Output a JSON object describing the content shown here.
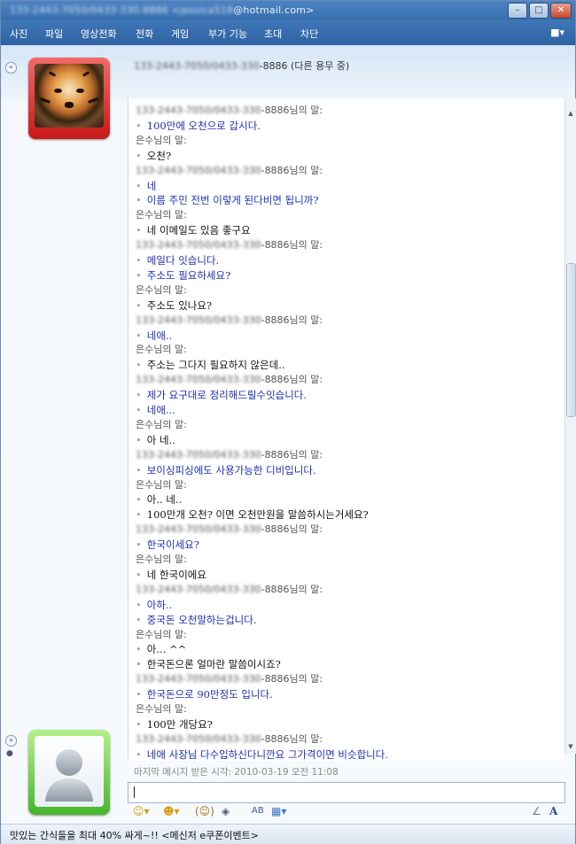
{
  "window": {
    "title_hidden": "133-2443-7050/0433-330-8886 <jessica518",
    "title_visible": "@hotmail.com>",
    "buttons": [
      "–",
      "□",
      "✕"
    ]
  },
  "menu": {
    "items": [
      "사진",
      "파일",
      "영상전화",
      "전화",
      "게임",
      "부가 기능",
      "초대",
      "차단"
    ],
    "right_icon": "■▾"
  },
  "contact": {
    "name_hidden": "133-2443-7050/0433-330",
    "name_visible": "-8886 (다른 용무 중)"
  },
  "chat": {
    "messages": [
      {
        "type": "speaker",
        "hidden": "133-2443-7050/0433-330",
        "text": "-8886님의 말:"
      },
      {
        "type": "msg",
        "side": "them",
        "text": "100만에 오천으로 갑시다."
      },
      {
        "type": "speaker",
        "hidden": "",
        "text": "은수님의 말:"
      },
      {
        "type": "msg",
        "side": "me",
        "text": "오천?"
      },
      {
        "type": "speaker",
        "hidden": "133-2443-7050/0433-330",
        "text": "-8886님의 말:"
      },
      {
        "type": "msg",
        "side": "them",
        "text": "네"
      },
      {
        "type": "msg",
        "side": "them",
        "text": "이름 주민 전번 이렇게 된다비면 됩니까?"
      },
      {
        "type": "speaker",
        "hidden": "",
        "text": "은수님의 말:"
      },
      {
        "type": "msg",
        "side": "me",
        "text": "네 이메일도 있음 좋구요"
      },
      {
        "type": "speaker",
        "hidden": "133-2443-7050/0433-330",
        "text": "-8886님의 말:"
      },
      {
        "type": "msg",
        "side": "them",
        "text": "메일다 잇습니다."
      },
      {
        "type": "msg",
        "side": "them",
        "text": "주소도 필요하세요?"
      },
      {
        "type": "speaker",
        "hidden": "",
        "text": "은수님의 말:"
      },
      {
        "type": "msg",
        "side": "me",
        "text": "주소도 있나요?"
      },
      {
        "type": "speaker",
        "hidden": "133-2443-7050/0433-330",
        "text": "-8886님의 말:"
      },
      {
        "type": "msg",
        "side": "them",
        "text": "네애.."
      },
      {
        "type": "speaker",
        "hidden": "",
        "text": "은수님의 말:"
      },
      {
        "type": "msg",
        "side": "me",
        "text": "주소는 그다지 필요하지 않은데.."
      },
      {
        "type": "speaker",
        "hidden": "133-2443-7050/0433-330",
        "text": "-8886님의 말:"
      },
      {
        "type": "msg",
        "side": "them",
        "text": "제가 요구대로 정리해드릴수잇습니다."
      },
      {
        "type": "msg",
        "side": "them",
        "text": "네애..."
      },
      {
        "type": "speaker",
        "hidden": "",
        "text": "은수님의 말:"
      },
      {
        "type": "msg",
        "side": "me",
        "text": "아 네.."
      },
      {
        "type": "speaker",
        "hidden": "133-2443-7050/0433-330",
        "text": "-8886님의 말:"
      },
      {
        "type": "msg",
        "side": "them",
        "text": "보이싱피싱에도 사용가능한 디비입니다."
      },
      {
        "type": "speaker",
        "hidden": "",
        "text": "은수님의 말:"
      },
      {
        "type": "msg",
        "side": "me",
        "text": "아.. 네.."
      },
      {
        "type": "msg",
        "side": "me",
        "text": "100만개 오천? 이면 오천만원을 말씀하시는거세요?"
      },
      {
        "type": "speaker",
        "hidden": "133-2443-7050/0433-330",
        "text": "-8886님의 말:"
      },
      {
        "type": "msg",
        "side": "them",
        "text": "한국이세요?"
      },
      {
        "type": "speaker",
        "hidden": "",
        "text": "은수님의 말:"
      },
      {
        "type": "msg",
        "side": "me",
        "text": "네 한국이에요"
      },
      {
        "type": "speaker",
        "hidden": "133-2443-7050/0433-330",
        "text": "-8886님의 말:"
      },
      {
        "type": "msg",
        "side": "them",
        "text": "아하.."
      },
      {
        "type": "msg",
        "side": "them",
        "text": "중국돈 오천말하는겁니다."
      },
      {
        "type": "speaker",
        "hidden": "",
        "text": "은수님의 말:"
      },
      {
        "type": "msg",
        "side": "me",
        "text": "아... ^^"
      },
      {
        "type": "msg",
        "side": "me",
        "text": "한국돈으론 얼마란 말씀이시죠?"
      },
      {
        "type": "speaker",
        "hidden": "133-2443-7050/0433-330",
        "text": "-8886님의 말:"
      },
      {
        "type": "msg",
        "side": "them",
        "text": "한국돈으로 90만정도 입니다."
      },
      {
        "type": "speaker",
        "hidden": "",
        "text": "은수님의 말:"
      },
      {
        "type": "msg",
        "side": "me",
        "text": "100만 개당요?"
      },
      {
        "type": "speaker",
        "hidden": "133-2443-7050/0433-330",
        "text": "-8886님의 말:"
      },
      {
        "type": "msg",
        "side": "them",
        "text": "네애 사장님 다수입하신다니깐요 그가격이면 비슷합니다."
      }
    ]
  },
  "status": {
    "last_received": "마지막 메시지 받은 시각: 2010-03-19 오전 11:08"
  },
  "toolbar": {
    "items": [
      "☺▾",
      "☻▾",
      "(☺)",
      "◈",
      "AB",
      "▦▾"
    ],
    "right": [
      "∠",
      "A"
    ]
  },
  "ad": {
    "text": "맛있는 간식들을 최대 40% 싸게~!! <메신저 e쿠폰이벤트>"
  },
  "colors": {
    "them_text": "#1c2fb0",
    "me_text": "#111111",
    "titlebar": "#3a6fae"
  }
}
